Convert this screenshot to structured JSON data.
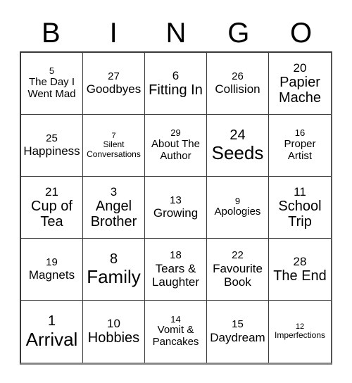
{
  "card": {
    "title": "BINGO",
    "header_letters": [
      "B",
      "I",
      "N",
      "G",
      "O"
    ],
    "grid_rows": 5,
    "grid_cols": 5,
    "colors": {
      "background": "#ffffff",
      "text": "#000000",
      "grid_line": "#3a3a3a",
      "grid_shadow": "#888888"
    },
    "cells": [
      [
        {
          "number": "5",
          "label": "The Day I Went Mad",
          "size": "sm"
        },
        {
          "number": "27",
          "label": "Goodbyes",
          "size": "md"
        },
        {
          "number": "6",
          "label": "Fitting In",
          "size": "lg"
        },
        {
          "number": "26",
          "label": "Collision",
          "size": "md"
        },
        {
          "number": "20",
          "label": "Papier Mache",
          "size": "lg"
        }
      ],
      [
        {
          "number": "25",
          "label": "Happiness",
          "size": "md"
        },
        {
          "number": "7",
          "label": "Silent Conversations",
          "size": "xs"
        },
        {
          "number": "29",
          "label": "About The Author",
          "size": "sm"
        },
        {
          "number": "24",
          "label": "Seeds",
          "size": "xl"
        },
        {
          "number": "16",
          "label": "Proper Artist",
          "size": "sm"
        }
      ],
      [
        {
          "number": "21",
          "label": "Cup of Tea",
          "size": "lg"
        },
        {
          "number": "3",
          "label": "Angel Brother",
          "size": "lg"
        },
        {
          "number": "13",
          "label": "Growing",
          "size": "md"
        },
        {
          "number": "9",
          "label": "Apologies",
          "size": "sm"
        },
        {
          "number": "11",
          "label": "School Trip",
          "size": "lg"
        }
      ],
      [
        {
          "number": "19",
          "label": "Magnets",
          "size": "md"
        },
        {
          "number": "8",
          "label": "Family",
          "size": "xl"
        },
        {
          "number": "18",
          "label": "Tears & Laughter",
          "size": "md"
        },
        {
          "number": "22",
          "label": "Favourite Book",
          "size": "md"
        },
        {
          "number": "28",
          "label": "The End",
          "size": "lg"
        }
      ],
      [
        {
          "number": "1",
          "label": "Arrival",
          "size": "xl"
        },
        {
          "number": "10",
          "label": "Hobbies",
          "size": "lg"
        },
        {
          "number": "14",
          "label": "Vomit & Pancakes",
          "size": "sm"
        },
        {
          "number": "15",
          "label": "Daydream",
          "size": "md"
        },
        {
          "number": "12",
          "label": "Imperfections",
          "size": "xs"
        }
      ]
    ]
  }
}
